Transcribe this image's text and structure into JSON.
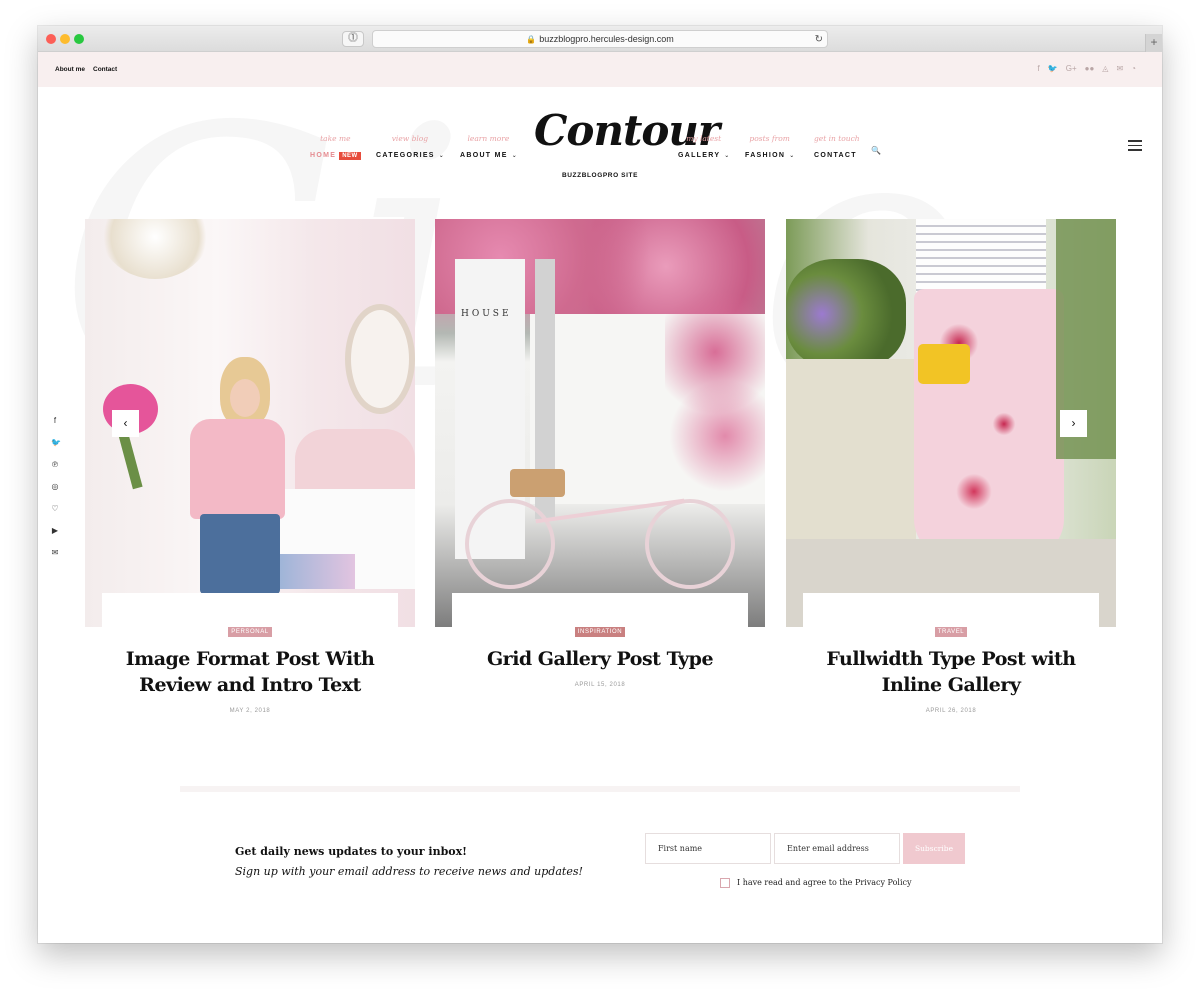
{
  "browser": {
    "url": "buzzblogpro.hercules-design.com"
  },
  "topbar": {
    "links": [
      "About me",
      "Contact"
    ],
    "social_icons": [
      "facebook-icon",
      "twitter-icon",
      "google-plus-icon",
      "flickr-icon",
      "snapchat-icon",
      "mail-icon",
      "rss-icon"
    ]
  },
  "nav": {
    "items": [
      {
        "sub": "take me",
        "label": "HOME",
        "badge": "NEW"
      },
      {
        "sub": "view blog",
        "label": "CATEGORIES"
      },
      {
        "sub": "learn more",
        "label": "ABOUT ME"
      },
      {
        "sub": "my latest",
        "label": "GALLERY"
      },
      {
        "sub": "posts from",
        "label": "FASHION"
      },
      {
        "sub": "get in touch",
        "label": "CONTACT"
      }
    ],
    "logo": "Contour",
    "tagline": "BUZZBLOGPRO SITE"
  },
  "side_social": [
    "facebook-icon",
    "twitter-icon",
    "pinterest-icon",
    "instagram-icon",
    "heart-icon",
    "youtube-icon",
    "mail-icon"
  ],
  "posts": [
    {
      "category": "PERSONAL",
      "title": "Image Format Post With Review and Intro Text",
      "date": "MAY 2, 2018",
      "image_text": ""
    },
    {
      "category": "INSPIRATION",
      "title": "Grid Gallery Post Type",
      "date": "APRIL 15, 2018",
      "image_text": "HOUSE"
    },
    {
      "category": "TRAVEL",
      "title": "Fullwidth Type Post with Inline Gallery",
      "date": "APRIL 26, 2018",
      "image_text": ""
    }
  ],
  "newsletter": {
    "title": "Get daily news updates to your inbox!",
    "subtitle": "Sign up with your email address to receive news and updates!",
    "first_name_placeholder": "First name",
    "email_placeholder": "Enter email address",
    "button": "Subscribe",
    "consent": "I have read and agree to the Privacy Policy"
  }
}
